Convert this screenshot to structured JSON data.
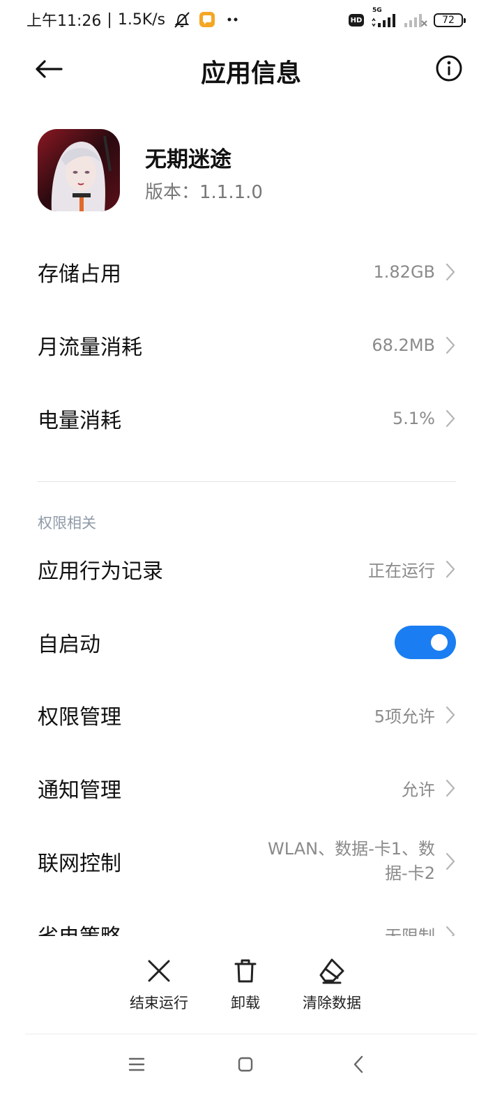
{
  "status_bar": {
    "time": "上午11:26",
    "speed": "1.5K/s",
    "hd": "HD",
    "network": "5G",
    "battery": "72",
    "icons": [
      "alarm-off-icon",
      "app-notification-icon",
      "more-dots-icon",
      "signal-icon",
      "signal-no-service-icon",
      "battery-icon"
    ]
  },
  "header": {
    "title": "应用信息",
    "back_icon": "arrow-left-icon",
    "info_icon": "info-circle-icon"
  },
  "app": {
    "name": "无期迷途",
    "version": "版本：1.1.1.0"
  },
  "rows": [
    {
      "label": "存储占用",
      "value": "1.82GB"
    },
    {
      "label": "月流量消耗",
      "value": "68.2MB"
    },
    {
      "label": "电量消耗",
      "value": "5.1%"
    }
  ],
  "permissions": {
    "section_title": "权限相关",
    "behavior": {
      "label": "应用行为记录",
      "value": "正在运行"
    },
    "autostart": {
      "label": "自启动",
      "enabled": true
    },
    "permission_manage": {
      "label": "权限管理",
      "value": "5项允许"
    },
    "notification_manage": {
      "label": "通知管理",
      "value": "允许"
    },
    "network_control": {
      "label": "联网控制",
      "value": "WLAN、数据-卡1、数据-卡2"
    },
    "power_saving": {
      "label": "省电策略",
      "value": "无限制"
    }
  },
  "actions": [
    {
      "label": "结束运行",
      "icon": "close-x-icon"
    },
    {
      "label": "卸载",
      "icon": "trash-icon"
    },
    {
      "label": "清除数据",
      "icon": "eraser-icon"
    }
  ],
  "nav_bar": {
    "icons": [
      "menu-icon",
      "home-square-icon",
      "back-chevron-icon"
    ]
  },
  "colors": {
    "accent": "#1a7ef2",
    "secondary_text": "#8a8a8a",
    "section_text": "#8f9aa8"
  }
}
